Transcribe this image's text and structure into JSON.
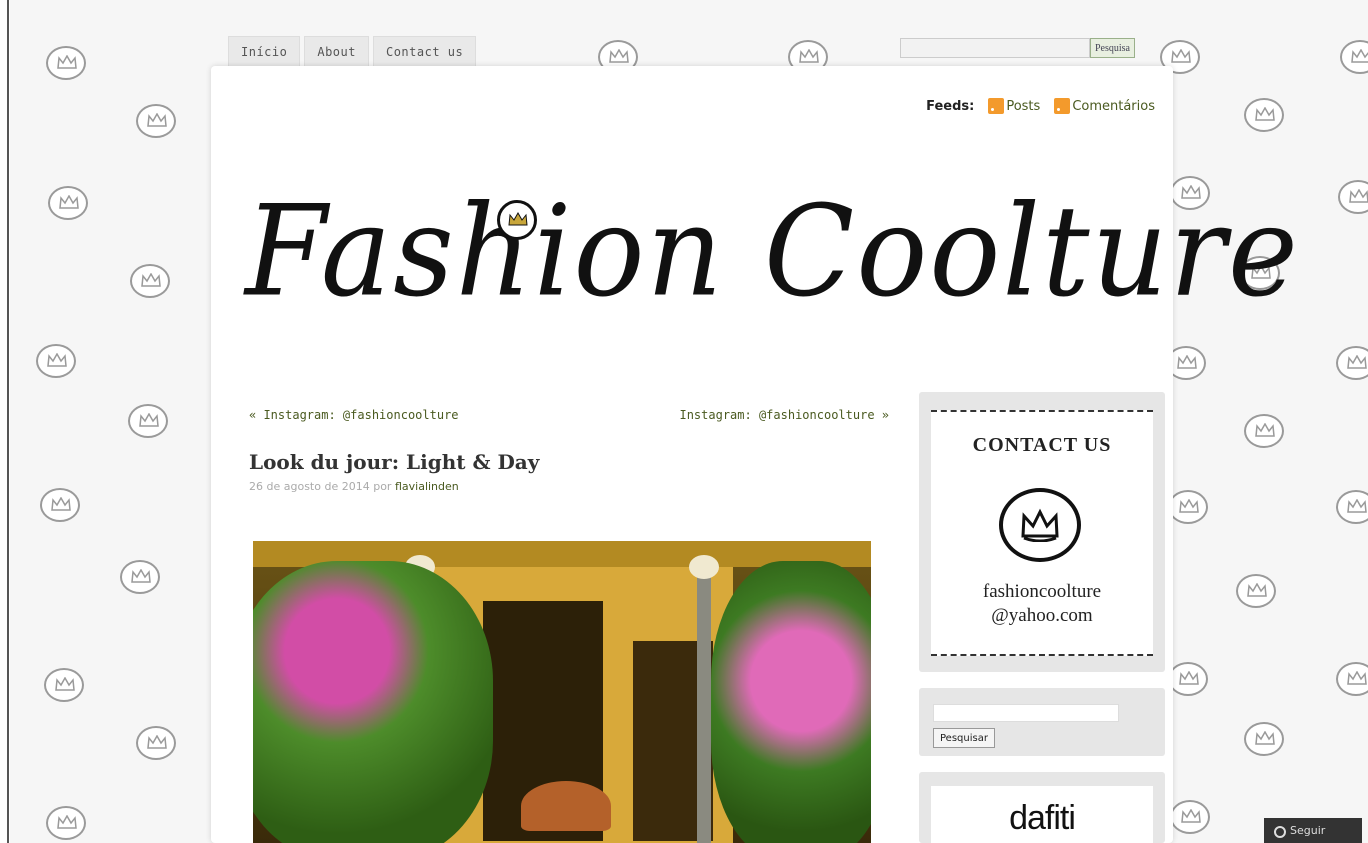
{
  "nav": {
    "tabs": [
      {
        "label": "Início"
      },
      {
        "label": "About"
      },
      {
        "label": "Contact us"
      }
    ]
  },
  "top_search": {
    "button_label": "Pesquisa"
  },
  "feeds": {
    "label": "Feeds:",
    "posts_label": "Posts",
    "comments_label": "Comentários"
  },
  "blog": {
    "title": "Fashion Coolture"
  },
  "post_nav": {
    "prev": "« Instagram: @fashioncoolture",
    "next": "Instagram: @fashioncoolture »"
  },
  "post": {
    "title": "Look du jour: Light & Day",
    "date": "26 de agosto de 2014",
    "by": "por",
    "author": "flavialinden"
  },
  "sidebar": {
    "contact_title": "CONTACT US",
    "contact_email_line1": "fashioncoolture",
    "contact_email_line2": "@yahoo.com",
    "search_button": "Pesquisar",
    "ad_text": "dafiti"
  },
  "follow": {
    "label": "Seguir"
  },
  "colors": {
    "link": "#4a5a20",
    "rss": "#f39a2c",
    "background": "#f6f6f6"
  }
}
